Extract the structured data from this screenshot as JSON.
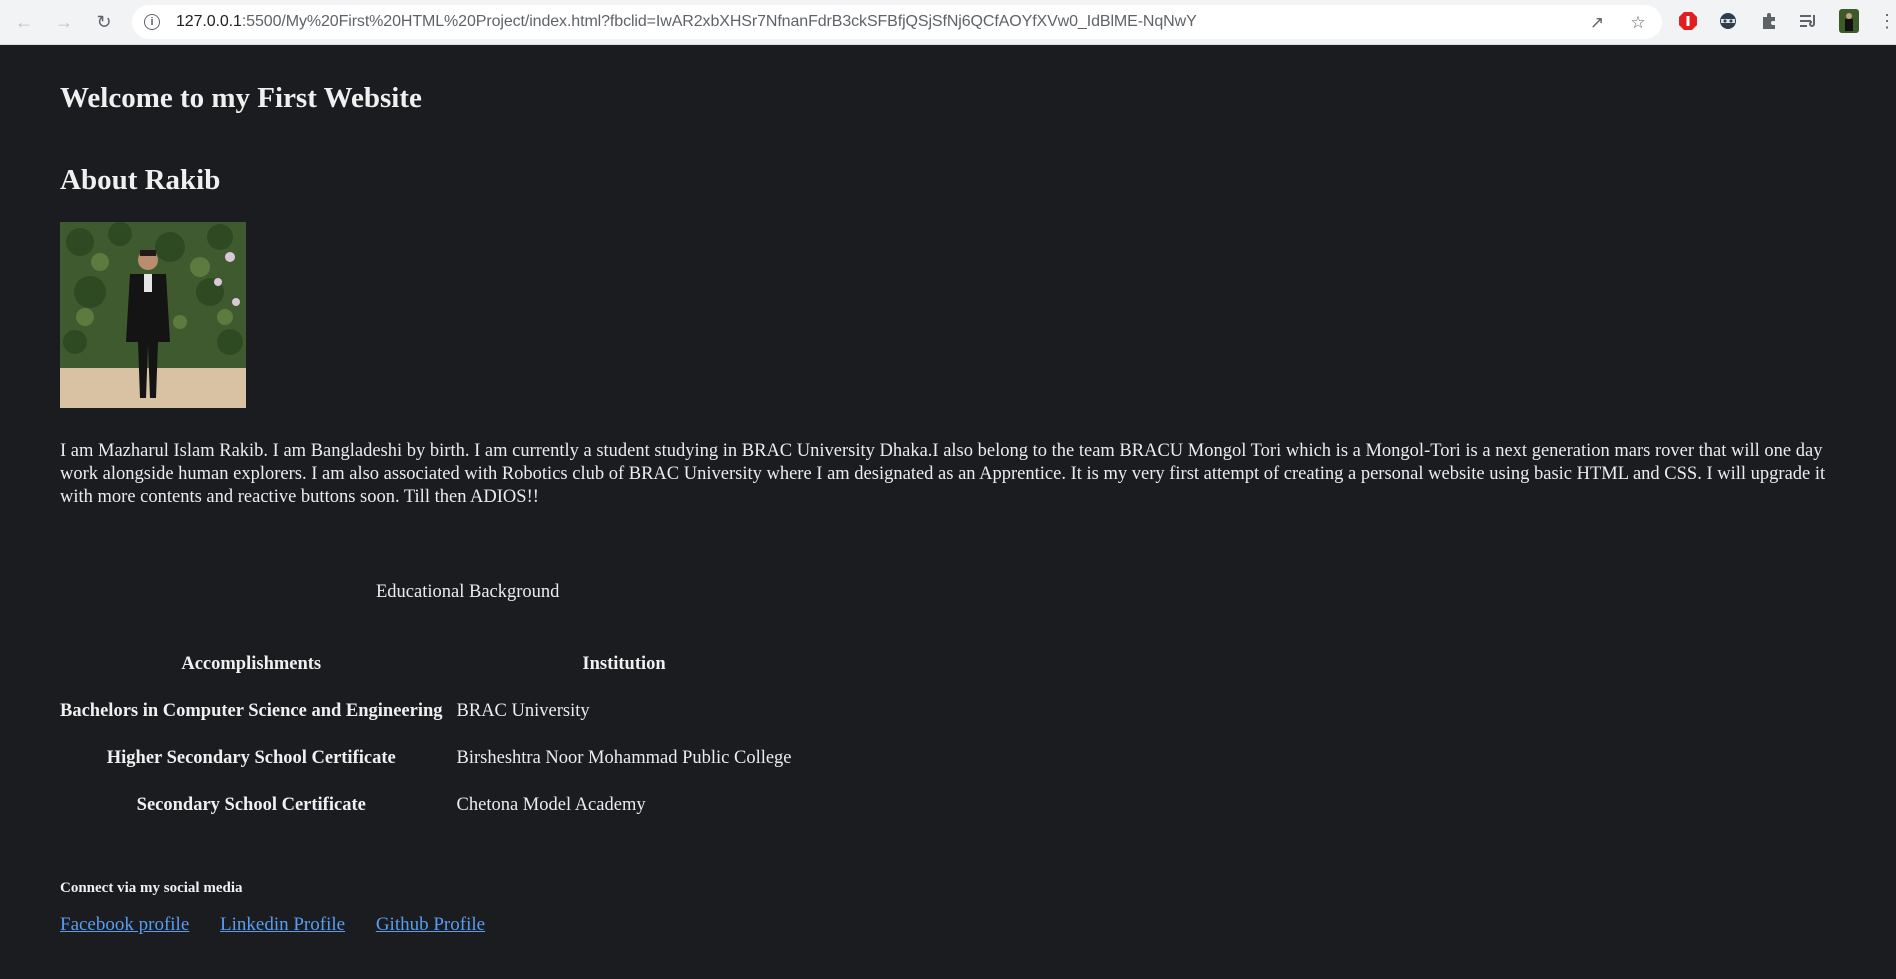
{
  "browser": {
    "url_host": "127.0.0.1",
    "url_rest": ":5500/My%20First%20HTML%20Project/index.html?fbclid=IwAR2xbXHSr7NfnanFdrB3ckSFBfjQSjSfNj6QCfAOYfXVw0_IdBlME-NqNwY"
  },
  "page": {
    "title": "Welcome to my First Website",
    "about_heading": "About Rakib",
    "bio": "I am Mazharul Islam Rakib. I am Bangladeshi by birth. I am currently a student studying in BRAC University Dhaka.I also belong to the team BRACU Mongol Tori which is a Mongol-Tori is a next generation mars rover that will one day work alongside human explorers. I am also associated with Robotics club of BRAC University where I am designated as an Apprentice. It is my very first attempt of creating a personal website using basic HTML and CSS. I will upgrade it with more contents and reactive buttons soon. Till then ADIOS!!"
  },
  "education": {
    "caption": "Educational Background",
    "headers": {
      "accomplishments": "Accomplishments",
      "institution": "Institution"
    },
    "rows": [
      {
        "accomplishment": "Bachelors in Computer Science and Engineering",
        "institution": "BRAC University"
      },
      {
        "accomplishment": "Higher Secondary School Certificate",
        "institution": "Birsheshtra Noor Mohammad Public College"
      },
      {
        "accomplishment": "Secondary School Certificate",
        "institution": "Chetona Model Academy"
      }
    ]
  },
  "social": {
    "heading": "Connect via my social media",
    "facebook": "Facebook profile",
    "linkedin": "Linkedin Profile",
    "github": "Github Profile"
  },
  "colors": {
    "background": "#1b1c1f",
    "link": "#5a9cf0"
  }
}
